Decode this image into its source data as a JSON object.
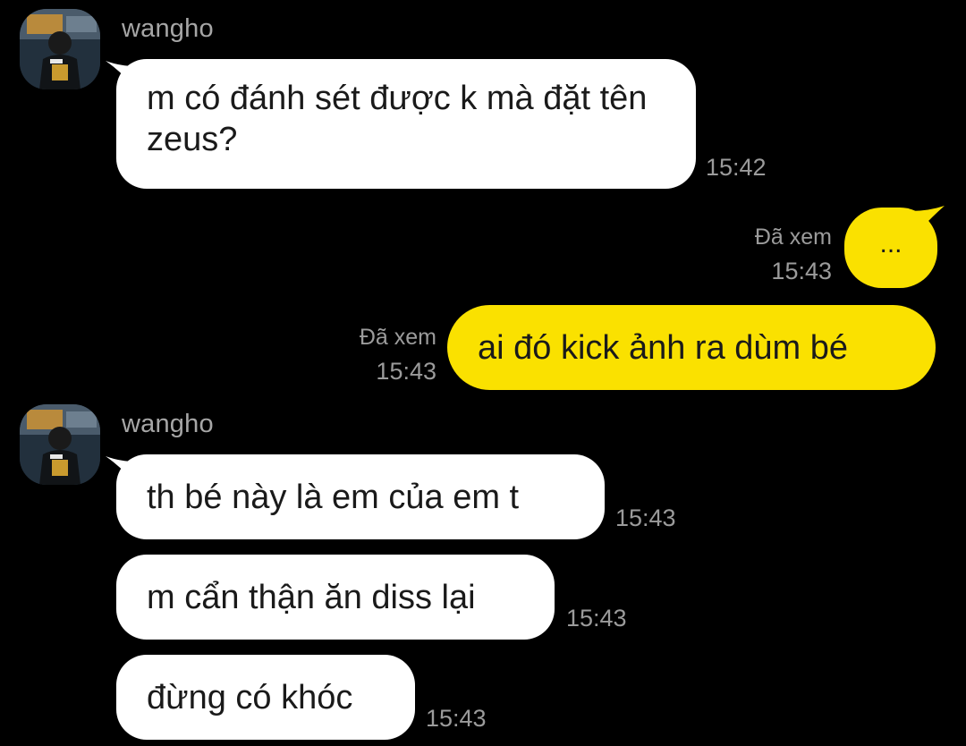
{
  "contact": {
    "name": "wangho"
  },
  "messages": [
    {
      "text": "m có đánh sét được k mà đặt tên zeus?",
      "time": "15:42"
    },
    {
      "text": "...",
      "time": "15:43",
      "status": "Đã xem"
    },
    {
      "text": "ai đó kick ảnh ra dùm bé",
      "time": "15:43",
      "status": "Đã xem"
    },
    {
      "text": "th bé này là em của em t",
      "time": "15:43"
    },
    {
      "text": "m cẩn thận ăn diss lại",
      "time": "15:43"
    },
    {
      "text": "đừng có khóc",
      "time": "15:43"
    }
  ],
  "colors": {
    "background": "#000000",
    "incoming_bubble": "#ffffff",
    "outgoing_bubble": "#fae100",
    "secondary_text": "#9b9b9b"
  }
}
